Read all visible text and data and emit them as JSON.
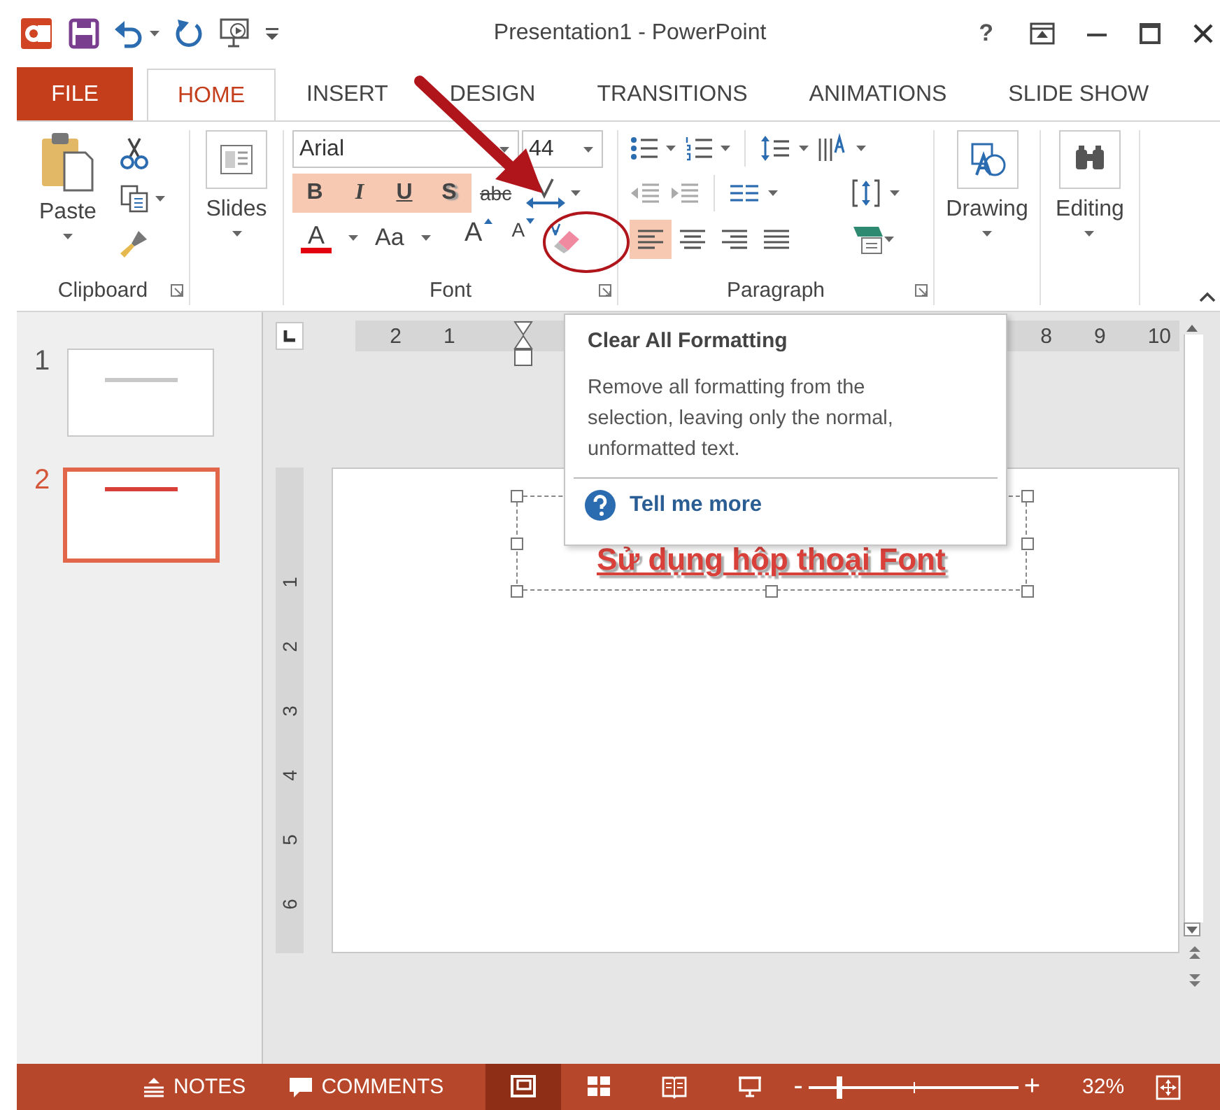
{
  "window": {
    "title": "Presentation1 - PowerPoint",
    "help": "?"
  },
  "tabs": [
    {
      "label": "FILE",
      "kind": "file",
      "selected": false
    },
    {
      "label": "HOME",
      "kind": "tab",
      "selected": true
    },
    {
      "label": "INSERT",
      "kind": "tab",
      "selected": false
    },
    {
      "label": "DESIGN",
      "kind": "tab",
      "selected": false
    },
    {
      "label": "TRANSITIONS",
      "kind": "tab",
      "selected": false
    },
    {
      "label": "ANIMATIONS",
      "kind": "tab",
      "selected": false
    },
    {
      "label": "SLIDE SHOW",
      "kind": "tab",
      "selected": false
    }
  ],
  "ribbon": {
    "clipboard": {
      "label": "Clipboard",
      "paste": "Paste"
    },
    "slides": {
      "button": "Slides"
    },
    "font": {
      "label": "Font",
      "font_name": "Arial",
      "font_size": "44",
      "format_buttons": [
        {
          "label": "B",
          "kind": "bold",
          "active": true
        },
        {
          "label": "I",
          "kind": "italic",
          "active": true
        },
        {
          "label": "U",
          "kind": "underline",
          "active": true
        },
        {
          "label": "S",
          "kind": "shadow",
          "active": true
        },
        {
          "label": "abc",
          "kind": "strikethrough",
          "active": false
        }
      ],
      "font_color": "A",
      "change_case": "Aa",
      "grow": "A",
      "shrink": "A"
    },
    "paragraph": {
      "label": "Paragraph",
      "align_buttons": [
        {
          "kind": "left",
          "selected": true
        },
        {
          "kind": "center",
          "selected": false
        },
        {
          "kind": "right",
          "selected": false
        },
        {
          "kind": "justify",
          "selected": false
        }
      ]
    },
    "drawing": {
      "button": "Drawing"
    },
    "editing": {
      "button": "Editing"
    }
  },
  "slides": [
    {
      "number": "1",
      "selected": false,
      "color": "#c8c8c8"
    },
    {
      "number": "2",
      "selected": true,
      "color": "#d9403a"
    }
  ],
  "rulers": {
    "left_labels": [
      "2",
      "1"
    ],
    "right_labels": [
      "8",
      "9",
      "10"
    ],
    "vertical": [
      "1",
      "2",
      "3",
      "4",
      "5",
      "6"
    ]
  },
  "slide_text": "Sử dụng hộp thoại Font",
  "tooltip": {
    "title": "Clear All Formatting",
    "body": "Remove all formatting from the selection, leaving only the normal, unformatted text.",
    "link": "Tell me more"
  },
  "status_bar": {
    "notes": "NOTES",
    "comments": "COMMENTS",
    "views": [
      {
        "kind": "normal",
        "selected": true
      },
      {
        "kind": "sorter",
        "selected": false
      },
      {
        "kind": "reading",
        "selected": false
      },
      {
        "kind": "slideshow",
        "selected": false
      }
    ],
    "zoom_out": "-",
    "zoom_in": "+",
    "zoom": {
      "level": 0.15
    },
    "zoom_label": "32%"
  }
}
